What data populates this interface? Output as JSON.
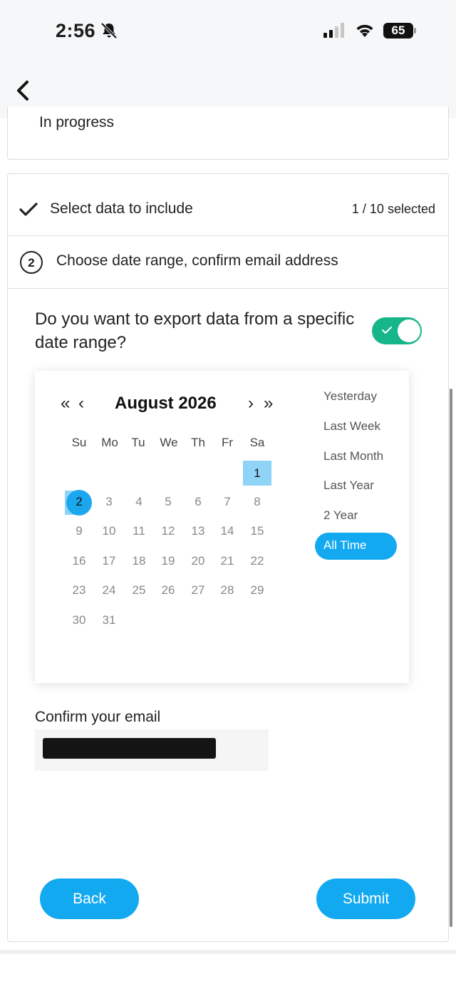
{
  "status_bar": {
    "time": "2:56",
    "battery": "65"
  },
  "progress_card": {
    "status": "In progress"
  },
  "steps": [
    {
      "label": "Select data to include",
      "count": "1 / 10 selected"
    },
    {
      "number": "2",
      "label": "Choose date range, confirm email address"
    }
  ],
  "date_range": {
    "question": "Do you want to export data from a specific date range?",
    "toggle_on": true
  },
  "calendar": {
    "prev_year": "«",
    "prev_month": "‹",
    "month_title": "August 2026",
    "next_month": "›",
    "next_year": "»",
    "weekdays": [
      "Su",
      "Mo",
      "Tu",
      "We",
      "Th",
      "Fr",
      "Sa"
    ],
    "days": [
      "1",
      "2",
      "3",
      "4",
      "5",
      "6",
      "7",
      "8",
      "9",
      "10",
      "11",
      "12",
      "13",
      "14",
      "15",
      "16",
      "17",
      "18",
      "19",
      "20",
      "21",
      "22",
      "23",
      "24",
      "25",
      "26",
      "27",
      "28",
      "29",
      "30",
      "31"
    ],
    "selected_days": [
      "1",
      "2"
    ]
  },
  "presets": [
    "Yesterday",
    "Last Week",
    "Last Month",
    "Last Year",
    "2 Year",
    "All Time"
  ],
  "active_preset": "All Time",
  "email": {
    "label": "Confirm your email"
  },
  "buttons": {
    "back": "Back",
    "submit": "Submit"
  },
  "colors": {
    "accent": "#12a9f0",
    "toggle": "#17b58a",
    "selected_day": "#8fd3f7"
  }
}
